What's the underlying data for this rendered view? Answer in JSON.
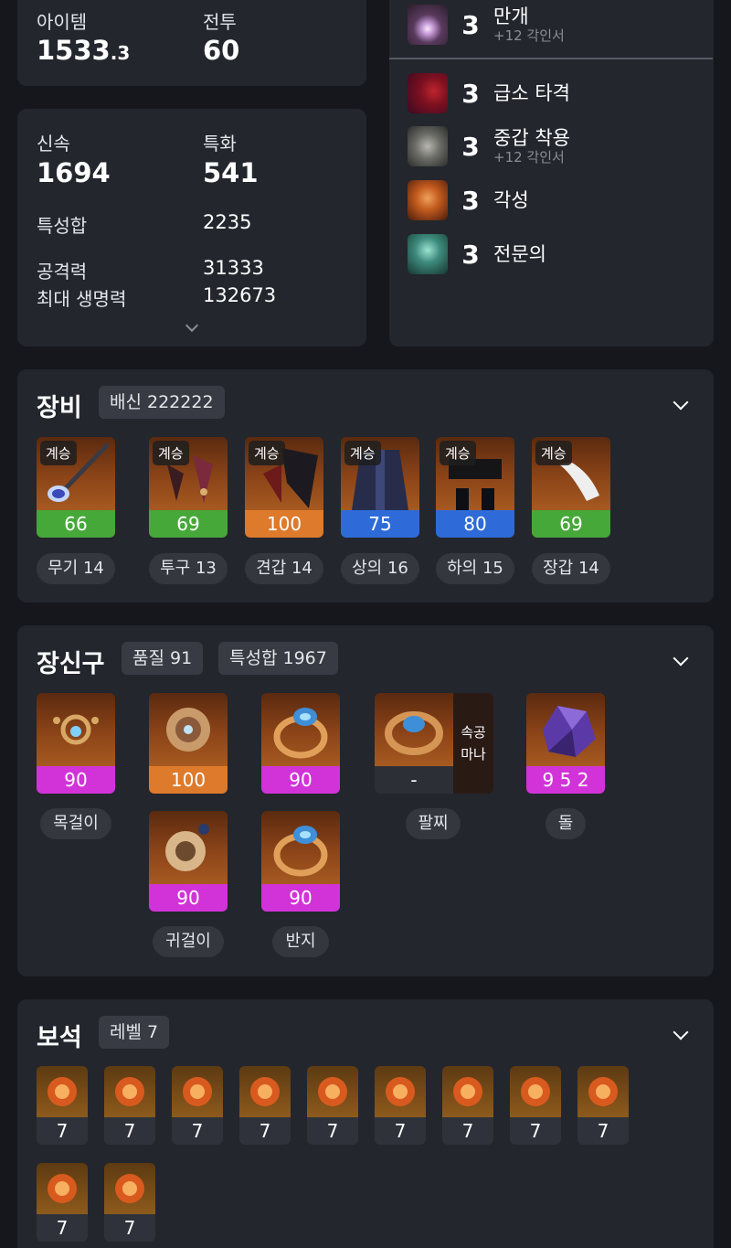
{
  "stats_top": {
    "item_label": "아이템",
    "item_value": "1533",
    "item_decimal": ".3",
    "battle_label": "전투",
    "battle_value": "60"
  },
  "stats": {
    "swift_label": "신속",
    "swift_value": "1694",
    "spec_label": "특화",
    "spec_value": "541",
    "trait_sum_label": "특성합",
    "trait_sum_value": "2235",
    "atk_label": "공격력",
    "atk_value": "31333",
    "hp_label": "최대 생명력",
    "hp_value": "132673"
  },
  "engravings": [
    {
      "level": "3",
      "name": "만개",
      "sub": "+12 각인서",
      "icon": "bloom-icon"
    },
    {
      "level": "3",
      "name": "급소 타격",
      "sub": "",
      "icon": "vital-strike-icon"
    },
    {
      "level": "3",
      "name": "중갑 착용",
      "sub": "+12 각인서",
      "icon": "heavy-armor-icon"
    },
    {
      "level": "3",
      "name": "각성",
      "sub": "",
      "icon": "awakening-icon"
    },
    {
      "level": "3",
      "name": "전문의",
      "sub": "",
      "icon": "expert-icon"
    }
  ],
  "equipment": {
    "title": "장비",
    "badge": "배신 222222",
    "items": [
      {
        "tag": "계승",
        "quality": "66",
        "label": "무기 14",
        "color": "#47a83a",
        "icon": "weapon-icon"
      },
      {
        "tag": "계승",
        "quality": "69",
        "label": "투구 13",
        "color": "#47a83a",
        "icon": "helmet-icon"
      },
      {
        "tag": "계승",
        "quality": "100",
        "label": "견갑 14",
        "color": "#de7a2c",
        "icon": "shoulder-icon"
      },
      {
        "tag": "계승",
        "quality": "75",
        "label": "상의 16",
        "color": "#2e6bd8",
        "icon": "chest-icon"
      },
      {
        "tag": "계승",
        "quality": "80",
        "label": "하의 15",
        "color": "#2e6bd8",
        "icon": "pants-icon"
      },
      {
        "tag": "계승",
        "quality": "69",
        "label": "장갑 14",
        "color": "#47a83a",
        "icon": "gloves-icon"
      }
    ]
  },
  "accessories": {
    "title": "장신구",
    "badge_quality": "품질 91",
    "badge_trait": "특성합 1967",
    "necklace": {
      "quality": "90",
      "label": "목걸이"
    },
    "earring1": {
      "quality": "100"
    },
    "earring2": {
      "quality": "90"
    },
    "earring_label": "귀걸이",
    "ring1": {
      "quality": "90"
    },
    "ring2": {
      "quality": "90"
    },
    "ring_label": "반지",
    "bracelet": {
      "quality": "-",
      "side_line1": "속공",
      "side_line2": "마나",
      "label": "팔찌"
    },
    "stone": {
      "value": "9 5 2",
      "label": "돌"
    }
  },
  "gems": {
    "title": "보석",
    "badge": "레벨 7",
    "levels": [
      "7",
      "7",
      "7",
      "7",
      "7",
      "7",
      "7",
      "7",
      "7",
      "7",
      "7"
    ]
  }
}
